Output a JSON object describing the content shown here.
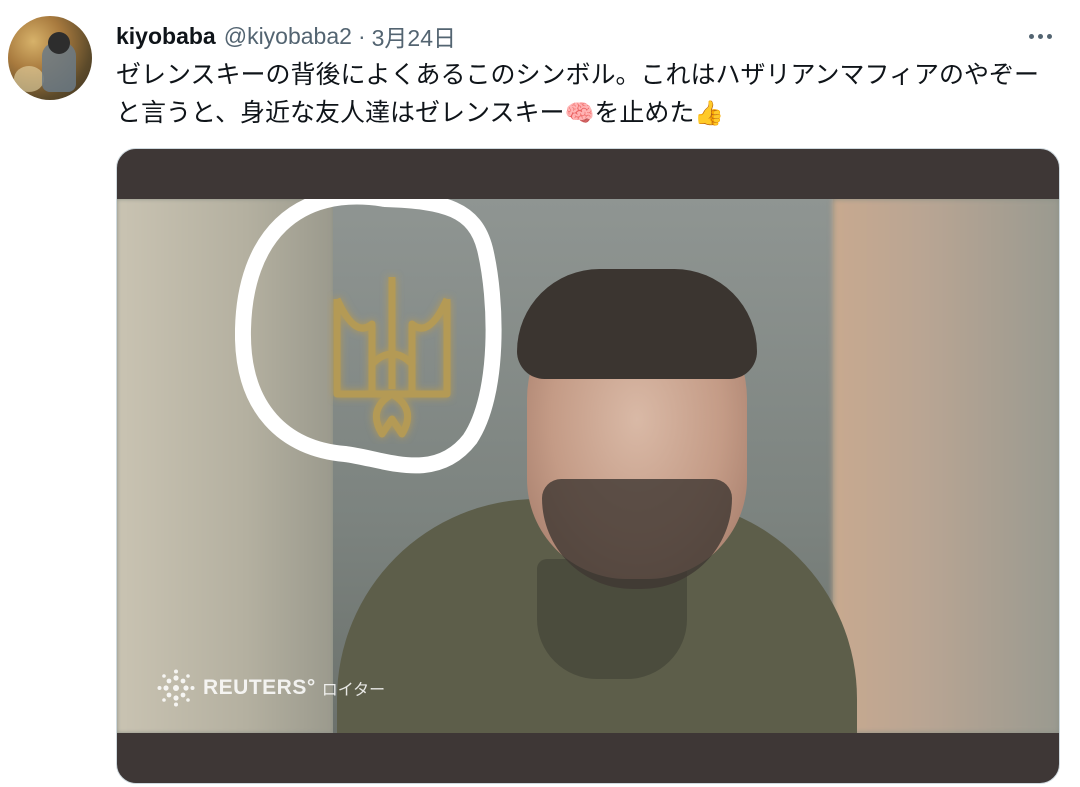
{
  "tweet": {
    "display_name": "kiyobaba",
    "handle": "@kiyobaba2",
    "separator": "·",
    "date": "3月24日",
    "text_line1": "ゼレンスキーの背後によくあるこのシンボル。これはハザリアンマフィアのやぞ",
    "text_line2": "ーと言うと、身近な友人達はゼレンスキー",
    "text_brain_emoji": "🧠",
    "text_line2_end": "を止めた",
    "text_thumb_emoji": "👍"
  },
  "media": {
    "watermark_brand": "REUTERS",
    "watermark_registered": "°",
    "watermark_jp": "ロイター"
  },
  "icons": {
    "more": "more-horizontal-icon",
    "brain": "brain-emoji",
    "thumb": "thumbs-up-emoji",
    "reuters": "reuters-logo-icon"
  },
  "colors": {
    "text": "#0f1419",
    "secondary": "#536471",
    "media_border": "#cfd9de",
    "letterbox": "#3e3736",
    "trident": "#b49a55",
    "annotation": "#ffffff"
  }
}
